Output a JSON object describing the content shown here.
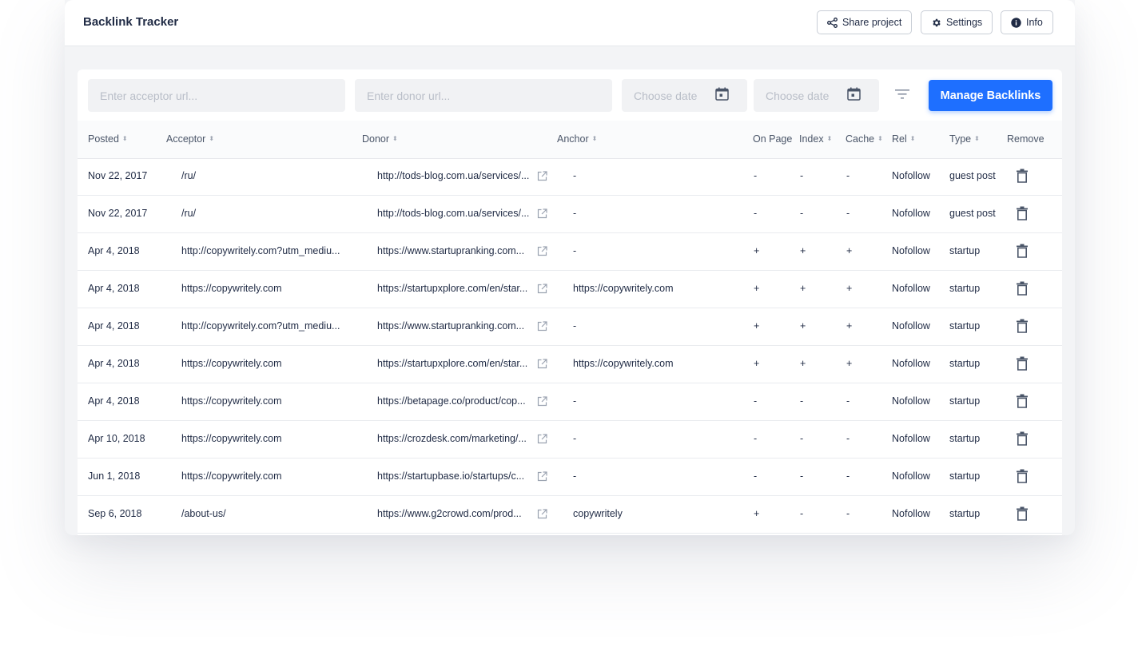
{
  "app": {
    "title": "Backlink Tracker"
  },
  "toolbar": {
    "share_label": "Share project",
    "settings_label": "Settings",
    "info_label": "Info"
  },
  "filters": {
    "acceptor_placeholder": "Enter acceptor url...",
    "donor_placeholder": "Enter donor url...",
    "date_from_placeholder": "Choose date",
    "date_to_placeholder": "Choose date",
    "manage_label": "Manage Backlinks"
  },
  "columns": {
    "posted": "Posted",
    "acceptor": "Acceptor",
    "donor": "Donor",
    "anchor": "Anchor",
    "on_page": "On Page",
    "index": "Index",
    "cache": "Cache",
    "rel": "Rel",
    "type": "Type",
    "remove": "Remove"
  },
  "rows": [
    {
      "posted": "Nov 22, 2017",
      "acceptor": "/ru/",
      "donor": "http://tods-blog.com.ua/services/...",
      "anchor": "-",
      "on_page": "-",
      "index": "-",
      "cache": "-",
      "rel": "Nofollow",
      "type": "guest post"
    },
    {
      "posted": "Nov 22, 2017",
      "acceptor": "/ru/",
      "donor": "http://tods-blog.com.ua/services/...",
      "anchor": "-",
      "on_page": "-",
      "index": "-",
      "cache": "-",
      "rel": "Nofollow",
      "type": "guest post"
    },
    {
      "posted": "Apr 4, 2018",
      "acceptor": "http://copywritely.com?utm_mediu...",
      "donor": "https://www.startupranking.com...",
      "anchor": "-",
      "on_page": "+",
      "index": "+",
      "cache": "+",
      "rel": "Nofollow",
      "type": "startup"
    },
    {
      "posted": "Apr 4, 2018",
      "acceptor": "https://copywritely.com",
      "donor": "https://startupxplore.com/en/star...",
      "anchor": "https://copywritely.com",
      "on_page": "+",
      "index": "+",
      "cache": "+",
      "rel": "Nofollow",
      "type": "startup"
    },
    {
      "posted": "Apr 4, 2018",
      "acceptor": "http://copywritely.com?utm_mediu...",
      "donor": "https://www.startupranking.com...",
      "anchor": "-",
      "on_page": "+",
      "index": "+",
      "cache": "+",
      "rel": "Nofollow",
      "type": "startup"
    },
    {
      "posted": "Apr 4, 2018",
      "acceptor": "https://copywritely.com",
      "donor": "https://startupxplore.com/en/star...",
      "anchor": "https://copywritely.com",
      "on_page": "+",
      "index": "+",
      "cache": "+",
      "rel": "Nofollow",
      "type": "startup"
    },
    {
      "posted": "Apr 4, 2018",
      "acceptor": "https://copywritely.com",
      "donor": "https://betapage.co/product/cop...",
      "anchor": "-",
      "on_page": "-",
      "index": "-",
      "cache": "-",
      "rel": "Nofollow",
      "type": "startup"
    },
    {
      "posted": "Apr 10, 2018",
      "acceptor": "https://copywritely.com",
      "donor": "https://crozdesk.com/marketing/...",
      "anchor": "-",
      "on_page": "-",
      "index": "-",
      "cache": "-",
      "rel": "Nofollow",
      "type": "startup"
    },
    {
      "posted": "Jun 1, 2018",
      "acceptor": "https://copywritely.com",
      "donor": "https://startupbase.io/startups/c...",
      "anchor": "-",
      "on_page": "-",
      "index": "-",
      "cache": "-",
      "rel": "Nofollow",
      "type": "startup"
    },
    {
      "posted": "Sep 6, 2018",
      "acceptor": "/about-us/",
      "donor": "https://www.g2crowd.com/prod...",
      "anchor": "copywritely",
      "on_page": "+",
      "index": "-",
      "cache": "-",
      "rel": "Nofollow",
      "type": "startup"
    }
  ],
  "colors": {
    "accent": "#1e6fff",
    "background": "#f3f4f6",
    "text": "#1f2a44"
  },
  "icons": {
    "share": "share-icon",
    "settings": "gear-icon",
    "info": "info-icon",
    "calendar": "calendar-icon",
    "filter": "filter-icon",
    "external": "external-link-icon",
    "remove": "trash-icon"
  }
}
